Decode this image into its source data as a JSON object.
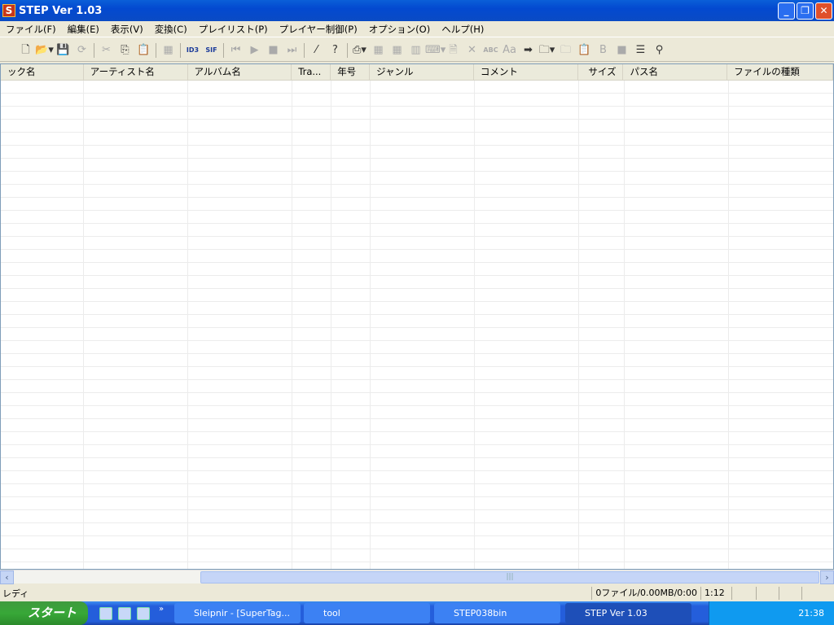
{
  "window": {
    "title": "STEP Ver 1.03",
    "app_icon": "S"
  },
  "menu": [
    "ファイル(F)",
    "編集(E)",
    "表示(V)",
    "変換(C)",
    "プレイリスト(P)",
    "プレイヤー制御(P)",
    "オプション(O)",
    "ヘルプ(H)"
  ],
  "toolbar": [
    {
      "icon": "new-file-icon",
      "glyph": "🗋",
      "enabled": true
    },
    {
      "icon": "open-folder-icon",
      "glyph": "📂▾",
      "enabled": true
    },
    {
      "icon": "save-icon",
      "glyph": "💾",
      "enabled": true
    },
    {
      "icon": "refresh-icon",
      "glyph": "⟳",
      "enabled": false
    },
    {
      "sep": true
    },
    {
      "icon": "cut-icon",
      "glyph": "✂",
      "enabled": false
    },
    {
      "icon": "copy-icon",
      "glyph": "⎘",
      "enabled": true
    },
    {
      "icon": "paste-icon",
      "glyph": "📋",
      "enabled": false
    },
    {
      "sep": true
    },
    {
      "icon": "grid-icon",
      "glyph": "▦",
      "enabled": false
    },
    {
      "sep": true
    },
    {
      "icon": "id3-tag-icon",
      "glyph": "ID3",
      "enabled": true
    },
    {
      "icon": "sif-id3v2-icon",
      "glyph": "SIF",
      "enabled": true
    },
    {
      "sep": true
    },
    {
      "icon": "previous-icon",
      "glyph": "⏮",
      "enabled": false
    },
    {
      "icon": "play-icon",
      "glyph": "▶",
      "enabled": false
    },
    {
      "icon": "stop-icon",
      "glyph": "■",
      "enabled": false
    },
    {
      "icon": "next-icon",
      "glyph": "⏭",
      "enabled": false
    },
    {
      "sep": true
    },
    {
      "icon": "wand-icon",
      "glyph": "⁄",
      "enabled": true
    },
    {
      "icon": "help-icon",
      "glyph": "?",
      "enabled": true
    },
    {
      "sep": true
    },
    {
      "icon": "convert-icon",
      "glyph": "⎙▾",
      "enabled": true
    },
    {
      "icon": "table-icon",
      "glyph": "▦",
      "enabled": false
    },
    {
      "icon": "table2-icon",
      "glyph": "▦",
      "enabled": false
    },
    {
      "icon": "columns-icon",
      "glyph": "▥",
      "enabled": false
    },
    {
      "icon": "keyboard-icon",
      "glyph": "⌨▾",
      "enabled": false
    },
    {
      "icon": "document-icon",
      "glyph": "🗎",
      "enabled": false
    },
    {
      "icon": "delete-icon",
      "glyph": "✕",
      "enabled": false
    },
    {
      "icon": "abc-icon",
      "glyph": "ABC",
      "enabled": false
    },
    {
      "icon": "case-icon",
      "glyph": "Aa",
      "enabled": false
    },
    {
      "icon": "arrow-list-icon",
      "glyph": "➡",
      "enabled": true
    },
    {
      "icon": "folder-star-icon",
      "glyph": "🗀▾",
      "enabled": true
    },
    {
      "icon": "folder-gray-icon",
      "glyph": "🗀",
      "enabled": false
    },
    {
      "icon": "clipboard-add-icon",
      "glyph": "📋",
      "enabled": true
    },
    {
      "icon": "filename-icon",
      "glyph": "B",
      "enabled": false
    },
    {
      "icon": "gray-box-icon",
      "glyph": "■",
      "enabled": false
    },
    {
      "icon": "sort-list-icon",
      "glyph": "☰",
      "enabled": true
    },
    {
      "icon": "plug-icon",
      "glyph": "⚲",
      "enabled": true
    }
  ],
  "columns": [
    {
      "label": "ック名",
      "width": 102
    },
    {
      "label": "アーティスト名",
      "width": 128
    },
    {
      "label": "アルバム名",
      "width": 128
    },
    {
      "label": "Tra...",
      "width": 48
    },
    {
      "label": "年号",
      "width": 48
    },
    {
      "label": "ジャンル",
      "width": 128
    },
    {
      "label": "コメント",
      "width": 128
    },
    {
      "label": "サイズ",
      "width": 56,
      "align": "right"
    },
    {
      "label": "パス名",
      "width": 128
    },
    {
      "label": "ファイルの種類",
      "width": 130
    }
  ],
  "status": {
    "left": "レディ",
    "files": "0ファイル/0.00MB/0:00",
    "time": "1:12"
  },
  "taskbar": {
    "start": "スタート",
    "tasks": [
      {
        "label": "Sleipnir - [SuperTag...",
        "active": false
      },
      {
        "label": "tool",
        "active": false
      },
      {
        "label": "STEP038bin",
        "active": false
      },
      {
        "label": "STEP Ver 1.03",
        "active": true
      }
    ],
    "clock": "21:38"
  }
}
